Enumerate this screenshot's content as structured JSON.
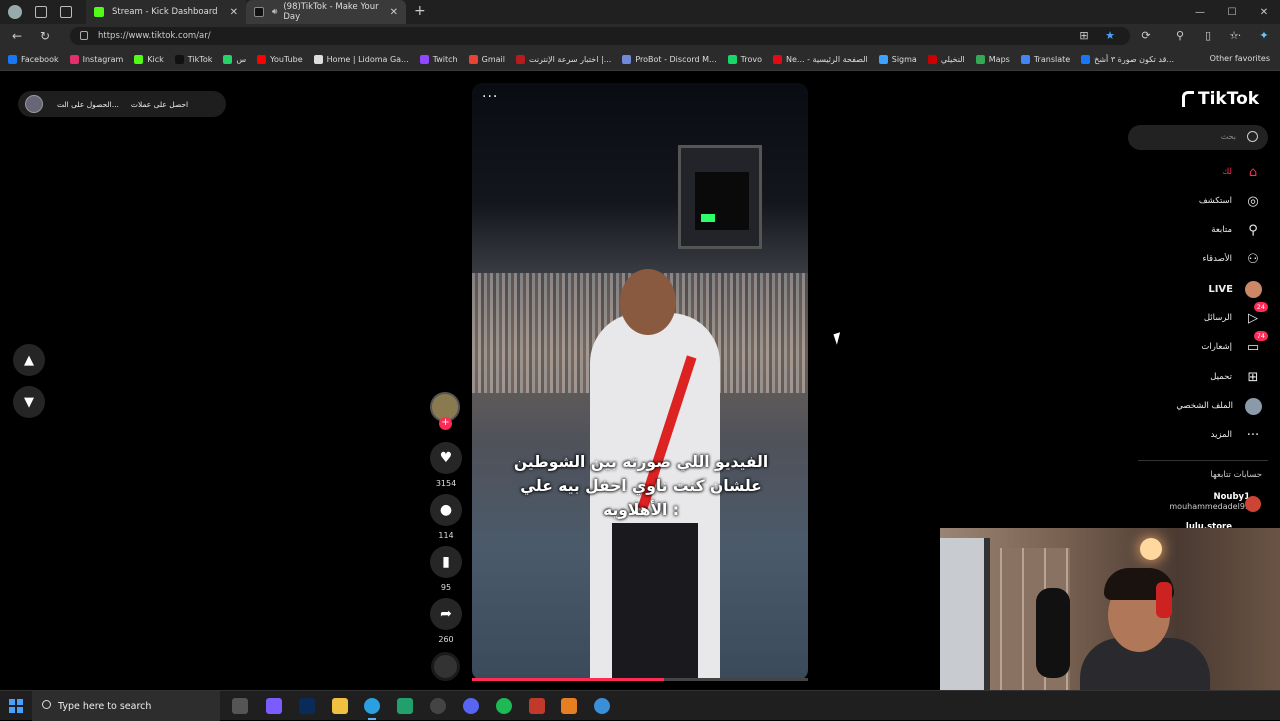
{
  "browser": {
    "tabs": [
      {
        "title": "Stream - Kick Dashboard",
        "close": "✕"
      },
      {
        "title": "(98)TikTok - Make Your Day",
        "close": "✕"
      }
    ],
    "new_tab": "+",
    "window_controls": [
      "—",
      "☐",
      "✕"
    ],
    "url": "https://www.tiktok.com/ar/"
  },
  "bookmarks": [
    {
      "label": "Facebook",
      "color": "#1877f2"
    },
    {
      "label": "Instagram",
      "color": "#e1306c"
    },
    {
      "label": "Kick",
      "color": "#53fc18"
    },
    {
      "label": "TikTok",
      "color": "#111111"
    },
    {
      "label": "س",
      "color": "#25d366"
    },
    {
      "label": "YouTube",
      "color": "#ff0000"
    },
    {
      "label": "Home | Lidoma Ga...",
      "color": "#dddddd"
    },
    {
      "label": "Twitch",
      "color": "#9146ff"
    },
    {
      "label": "Gmail",
      "color": "#ea4335"
    },
    {
      "label": "اختبار سرعة الإنترنت |...",
      "color": "#b71c1c"
    },
    {
      "label": "ProBot - Discord M...",
      "color": "#7289da"
    },
    {
      "label": "Trovo",
      "color": "#19d66b"
    },
    {
      "label": "Ne... - الصفحة الرئيسية",
      "color": "#e50914"
    },
    {
      "label": "Sigma",
      "color": "#3da1ff"
    },
    {
      "label": "النخيلي",
      "color": "#cc0000"
    },
    {
      "label": "Maps",
      "color": "#34a853"
    },
    {
      "label": "Translate",
      "color": "#4285f4"
    },
    {
      "label": "قد تكون صورة ٣ أشخ...",
      "color": "#1877f2"
    }
  ],
  "other_favorites": "Other favorites",
  "ads_pill": {
    "item1": "الحصول على الت...",
    "item2": "احصل على عملات"
  },
  "video": {
    "caption_lines": [
      "الفيديو اللي صورته بين الشوطين",
      "علشان كنت ناوي احفل بيه علي",
      "الأهلاويه :"
    ],
    "more": "···",
    "progress_fraction": 0.57
  },
  "actions": {
    "likes": "3154",
    "comments": "114",
    "saves": "95",
    "shares": "260",
    "follow_plus": "+"
  },
  "sidebar": {
    "logo": "TikTok",
    "search_placeholder": "بحث",
    "items": [
      {
        "label": "لك",
        "icon": "home-icon",
        "glyph": "⌂"
      },
      {
        "label": "استكشف",
        "icon": "compass-icon",
        "glyph": "◎"
      },
      {
        "label": "متابعة",
        "icon": "following-icon",
        "glyph": "⚲"
      },
      {
        "label": "الأصدقاء",
        "icon": "friends-icon",
        "glyph": "⚇"
      },
      {
        "label": "LIVE",
        "icon": "live-avatar-icon",
        "glyph": ""
      },
      {
        "label": "الرسائل",
        "icon": "messages-icon",
        "glyph": "▷",
        "badge": "24"
      },
      {
        "label": "إشعارات",
        "icon": "notifications-icon",
        "glyph": "▭",
        "badge": "74"
      },
      {
        "label": "تحميل",
        "icon": "upload-icon",
        "glyph": "⊞"
      },
      {
        "label": "الملف الشخصي",
        "icon": "profile-avatar-icon",
        "glyph": ""
      },
      {
        "label": "المزيد",
        "icon": "more-icon",
        "glyph": "···"
      }
    ],
    "following_title": "حسابات تتابعها",
    "accounts": [
      {
        "name": "Nouby1",
        "handle": "mouhammedadel99"
      },
      {
        "name": "lulu.store",
        "handle": ""
      }
    ]
  },
  "taskbar": {
    "search_placeholder": "Type here to search"
  },
  "colors": {
    "accent": "#fe2c55",
    "background": "#000000"
  }
}
